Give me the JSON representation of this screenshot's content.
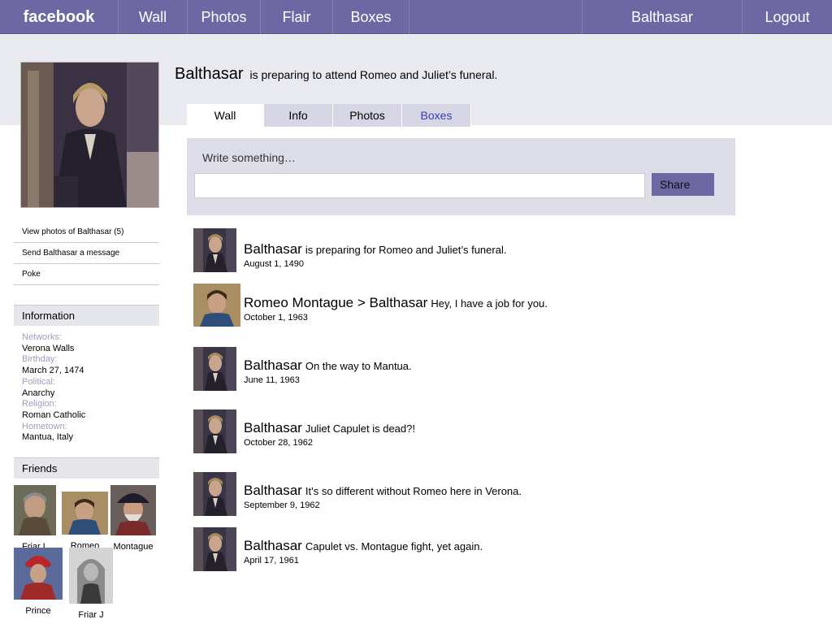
{
  "nav": {
    "brand": "facebook",
    "items": [
      "Wall",
      "Photos",
      "Flair",
      "Boxes"
    ],
    "user": "Balthasar",
    "logout": "Logout"
  },
  "profile": {
    "name": "Balthasar",
    "status": "is preparing to attend Romeo and Juliet’s funeral."
  },
  "tabs": [
    "Wall",
    "Info",
    "Photos",
    "Boxes"
  ],
  "composer": {
    "prompt": "Write something…",
    "share_label": "Share"
  },
  "sidebar": {
    "links": [
      "View photos of Balthasar (5)",
      "Send Balthasar a message",
      "Poke"
    ],
    "information_title": "Information",
    "information": [
      {
        "label": "Networks:",
        "value": "Verona Walls"
      },
      {
        "label": "Birthday:",
        "value": "March 27, 1474"
      },
      {
        "label": "Political:",
        "value": "Anarchy"
      },
      {
        "label": "Religion:",
        "value": "Roman Catholic"
      },
      {
        "label": "Hometown:",
        "value": "Mantua, Italy"
      }
    ],
    "friends_title": "Friends",
    "friends": [
      "Friar L",
      "Romeo",
      "Montague",
      "Prince",
      "Friar J"
    ]
  },
  "posts": [
    {
      "author": "Balthasar",
      "message": "is preparing for Romeo and Juliet’s funeral.",
      "date": "August 1, 1490"
    },
    {
      "author": "Romeo Montague > Balthasar",
      "message": "Hey, I have a job for you.",
      "date": "October 1, 1963"
    },
    {
      "author": "Balthasar",
      "message": "On the way to Mantua.",
      "date": "June 11, 1963"
    },
    {
      "author": "Balthasar",
      "message": "Juliet Capulet is dead?!",
      "date": "October 28, 1962"
    },
    {
      "author": "Balthasar",
      "message": "It’s so different without Romeo here in Verona.",
      "date": "September 9, 1962"
    },
    {
      "author": "Balthasar",
      "message": "Capulet vs. Montague fight, yet again.",
      "date": "April 17, 1961"
    }
  ],
  "colors": {
    "topbar": "#6d67a3",
    "band": "#e9e9f0",
    "link": "#3b3bb8",
    "info_label": "#9d9dbf"
  }
}
